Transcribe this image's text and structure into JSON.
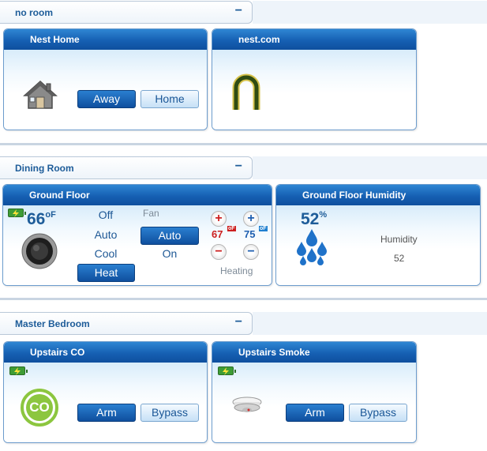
{
  "rooms": [
    {
      "name": "no room",
      "collapse": "−"
    },
    {
      "name": "Dining Room",
      "collapse": "−"
    },
    {
      "name": "Master Bedroom",
      "collapse": "−"
    }
  ],
  "nest_home": {
    "title": "Nest Home",
    "away_label": "Away",
    "home_label": "Home",
    "selected": "Away"
  },
  "nest_com": {
    "title": "nest.com",
    "icon": "nest-logo-icon"
  },
  "thermostat": {
    "title": "Ground Floor",
    "current_temp": "66",
    "temp_unit": "oF",
    "modes": [
      "Off",
      "Auto",
      "Cool",
      "Heat"
    ],
    "selected_mode": "Heat",
    "fan_label": "Fan",
    "fan_modes": [
      "Auto",
      "On"
    ],
    "selected_fan": "Auto",
    "heat_setpoint": "67",
    "heat_unit": "oF",
    "cool_setpoint": "75",
    "cool_unit": "oF",
    "status": "Heating"
  },
  "humidity": {
    "title": "Ground Floor Humidity",
    "value": "52",
    "unit": "%",
    "label": "Humidity",
    "reading": "52"
  },
  "co_sensor": {
    "title": "Upstairs CO",
    "icon_text": "CO",
    "arm_label": "Arm",
    "bypass_label": "Bypass",
    "selected": "Arm"
  },
  "smoke_sensor": {
    "title": "Upstairs Smoke",
    "arm_label": "Arm",
    "bypass_label": "Bypass",
    "selected": "Arm"
  },
  "colors": {
    "accent": "#1660b3",
    "heat": "#cc1f1f",
    "cool": "#1f5fb0",
    "co_green": "#8cc63f",
    "battery": "#3e9c35"
  }
}
